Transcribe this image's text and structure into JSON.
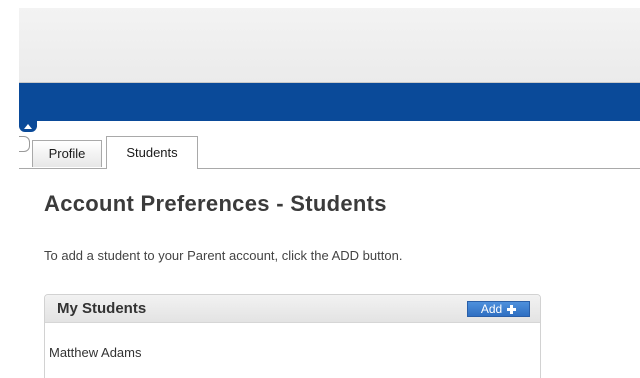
{
  "tabs": [
    {
      "label": "Profile",
      "selected": false
    },
    {
      "label": "Students",
      "selected": true
    }
  ],
  "main": {
    "title": "Account Preferences - Students",
    "instruction": "To add a student to your Parent account, click the ADD button."
  },
  "students_panel": {
    "title": "My Students",
    "add_label": "Add",
    "add_icon": "plus-icon",
    "students": [
      "Matthew Adams"
    ]
  },
  "colors": {
    "nav_bar": "#0a4a99",
    "add_button": "#3a7dd0"
  }
}
